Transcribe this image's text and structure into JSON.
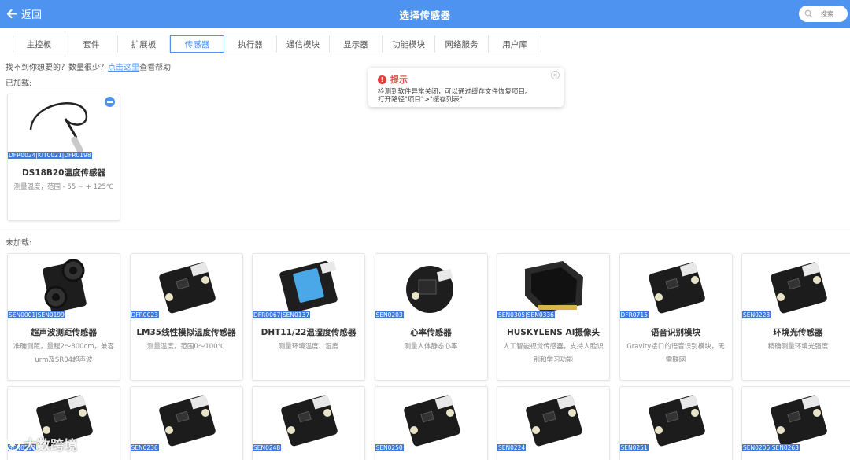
{
  "header": {
    "back_label": "返回",
    "title": "选择传感器",
    "search_placeholder": "搜索"
  },
  "tabs": [
    {
      "label": "主控板",
      "w": 66
    },
    {
      "label": "套件",
      "w": 67
    },
    {
      "label": "扩展板",
      "w": 66
    },
    {
      "label": "传感器",
      "w": 69,
      "active": true
    },
    {
      "label": "执行器",
      "w": 67
    },
    {
      "label": "通信模块",
      "w": 67
    },
    {
      "label": "显示器",
      "w": 67
    },
    {
      "label": "功能模块",
      "w": 67
    },
    {
      "label": "网络服务",
      "w": 68
    },
    {
      "label": "用户库",
      "w": 66
    }
  ],
  "help": {
    "prefix": "找不到你想要的？数量很少？",
    "link": "点击这里",
    "suffix": "查看帮助"
  },
  "loaded_label": "已加载:",
  "unloaded_label": "未加载:",
  "toast": {
    "title": "提示",
    "line1": "检测到软件异常关闭，可以通过缓存文件恢复项目。",
    "line2": "打开路径\"项目\">\"缓存列表\""
  },
  "loaded": [
    {
      "sku": "DFR0024|KIT0021|DFR0198",
      "title": "DS18B20温度传感器",
      "desc": "测量温度，范围 - 55 ~ + 125℃",
      "img": "probe"
    }
  ],
  "unloaded": [
    {
      "sku": "SEN0001|SEN0199",
      "title": "超声波测距传感器",
      "desc": "准确测距，量程2～800cm，兼容urm及SR04超声波",
      "img": "ultrasonic"
    },
    {
      "sku": "DFR0023",
      "title": "LM35线性模拟温度传感器",
      "desc": "测量温度，范围0～100℃",
      "img": "board"
    },
    {
      "sku": "DFR0067|SEN0137",
      "title": "DHT11/22温湿度传感器",
      "desc": "测量环境温度、湿度",
      "img": "dht"
    },
    {
      "sku": "SEN0203",
      "title": "心率传感器",
      "desc": "测量人体静态心率",
      "img": "round"
    },
    {
      "sku": "SEN0305|SEN0336",
      "title": "HUSKYLENS AI摄像头",
      "desc": "人工智能视觉传感器，支持人脸识别和学习功能",
      "img": "camera"
    },
    {
      "sku": "DFR0715",
      "title": "语音识别模块",
      "desc": "Gravity接口的语音识别模块，无需联网",
      "img": "board"
    },
    {
      "sku": "SEN0228",
      "title": "环境光传感器",
      "desc": "精确测量环境光强度",
      "img": "board"
    },
    {
      "sku": "SEN0517",
      "title": "",
      "desc": "",
      "img": "board"
    },
    {
      "sku": "SEN0236",
      "title": "",
      "desc": "",
      "img": "board"
    },
    {
      "sku": "SEN0248",
      "title": "",
      "desc": "",
      "img": "board"
    },
    {
      "sku": "SEN0250",
      "title": "",
      "desc": "",
      "img": "board"
    },
    {
      "sku": "SEN0224",
      "title": "",
      "desc": "",
      "img": "board"
    },
    {
      "sku": "SEN0251",
      "title": "",
      "desc": "",
      "img": "board"
    },
    {
      "sku": "SEN0206|SEN0263",
      "title": "",
      "desc": "",
      "img": "board"
    }
  ],
  "watermark": "大数跨境"
}
